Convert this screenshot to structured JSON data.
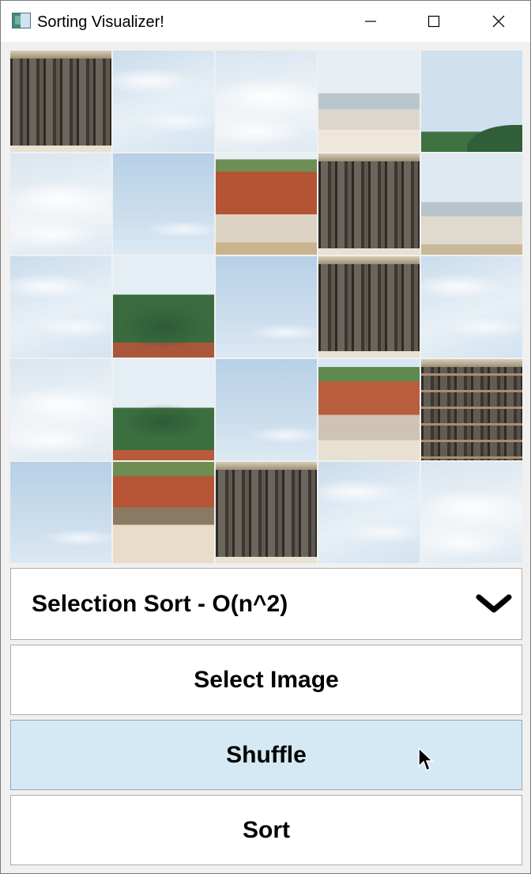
{
  "window": {
    "title": "Sorting Visualizer!"
  },
  "algorithm_select": {
    "selected": "Selection Sort - O(n^2)"
  },
  "buttons": {
    "select_image": "Select Image",
    "shuffle": "Shuffle",
    "sort": "Sort"
  },
  "icons": {
    "app": "app-icon",
    "minimize": "minimize-icon",
    "maximize": "maximize-icon",
    "close": "close-icon",
    "dropdown": "chevron-down-icon",
    "cursor": "mouse-cursor-icon"
  },
  "colors": {
    "hovered_button": "#d4e9f3",
    "button_border": "#adadad"
  }
}
